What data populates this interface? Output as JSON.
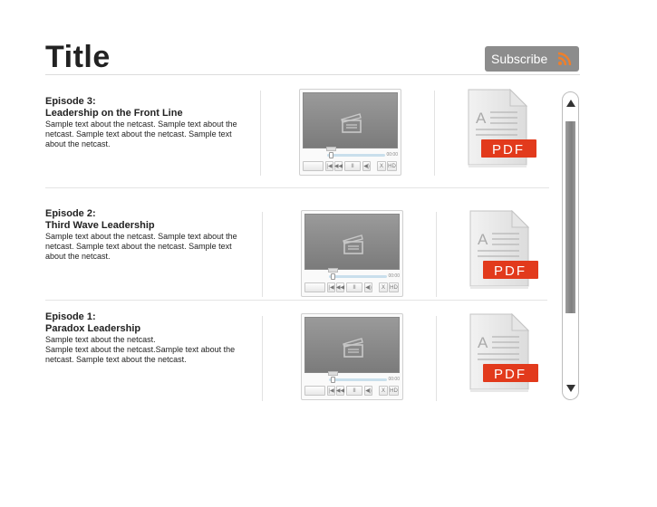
{
  "header": {
    "title": "Title",
    "subscribe_label": "Subscribe",
    "accent_color": "#f07f2a"
  },
  "episodes": [
    {
      "number": "Episode 3:",
      "name": "Leadership on the Front Line",
      "description": "Sample text about the netcast. Sample text about the netcast. Sample text about the netcast. Sample text about the netcast.",
      "pdf_label": "PDF",
      "player_time": "00:00"
    },
    {
      "number": "Episode 2:",
      "name": "Third Wave Leadership",
      "description": "Sample text about the netcast. Sample text about the netcast. Sample text about the netcast. Sample text about the netcast.",
      "pdf_label": "PDF",
      "player_time": "00:00"
    },
    {
      "number": "Episode 1:",
      "name": "Paradox Leadership",
      "description_line1": "Sample text about the netcast.",
      "description": "Sample text about the netcast.Sample text about the netcast. Sample text about the netcast.",
      "pdf_label": "PDF",
      "player_time": "00:00"
    }
  ],
  "player_controls": [
    "|◀",
    "◀◀",
    "II",
    "◀)",
    "X",
    "HD"
  ],
  "icons": {
    "rss": "rss-icon",
    "clapperboard": "clapperboard-icon",
    "pdf": "pdf-document-icon",
    "scroll_up": "arrow-up-icon",
    "scroll_down": "arrow-down-icon"
  }
}
